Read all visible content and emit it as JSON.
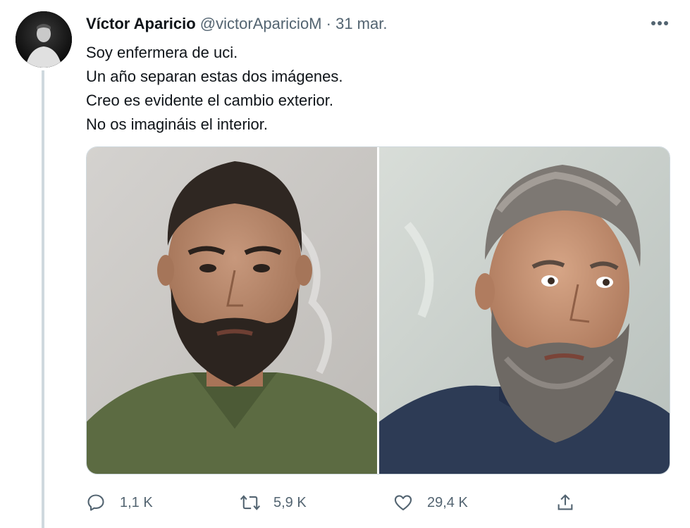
{
  "tweet": {
    "author_name": "Víctor Aparicio",
    "author_handle": "@victorAparicioM",
    "separator": "·",
    "date": "31 mar.",
    "text_lines": [
      "Soy enfermera de uci.",
      "Un año separan estas dos imágenes.",
      "Creo es evidente el cambio exterior.",
      "No os imagináis el interior."
    ],
    "media": [
      {
        "icon": "photo-before"
      },
      {
        "icon": "photo-after"
      }
    ],
    "actions": {
      "reply_count": "1,1 K",
      "retweet_count": "5,9 K",
      "like_count": "29,4 K"
    }
  },
  "icons": {
    "more": "more-horizontal-icon",
    "reply": "reply-icon",
    "retweet": "retweet-icon",
    "like": "heart-icon",
    "share": "share-icon"
  },
  "colors": {
    "text_primary": "#0f1419",
    "text_secondary": "#536471",
    "thread_line": "#cfd9de"
  }
}
